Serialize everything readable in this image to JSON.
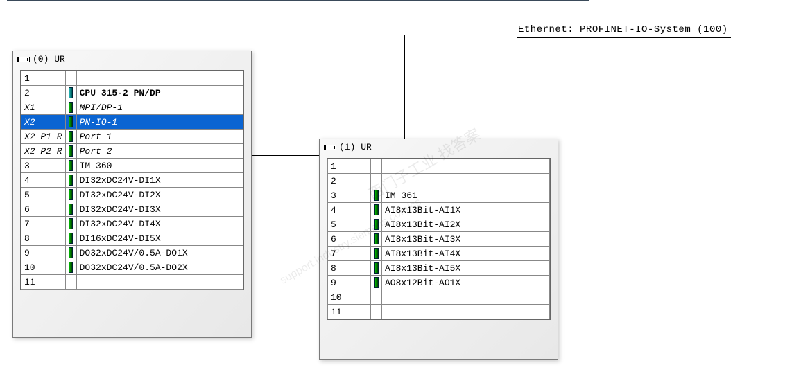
{
  "network_label": "Ethernet: PROFINET-IO-System (100)",
  "rack0": {
    "title": "(0) UR",
    "rows": [
      {
        "slot": "1",
        "icon": "",
        "module": ""
      },
      {
        "slot": "2",
        "icon": "teal",
        "module": "CPU 315-2 PN/DP",
        "bold": true
      },
      {
        "slot": "X1",
        "icon": "green",
        "module": "MPI/DP-1",
        "italic": true,
        "slotItalic": true
      },
      {
        "slot": "X2",
        "icon": "green",
        "module": "PN-IO-1",
        "italic": true,
        "slotItalic": true,
        "selected": true
      },
      {
        "slot": "X2 P1 R",
        "icon": "green",
        "module": "Port 1",
        "italic": true,
        "slotItalic": true
      },
      {
        "slot": "X2 P2 R",
        "icon": "green",
        "module": "Port 2",
        "italic": true,
        "slotItalic": true
      },
      {
        "slot": "3",
        "icon": "green",
        "module": "IM 360"
      },
      {
        "slot": "4",
        "icon": "green",
        "module": "DI32xDC24V-DI1X"
      },
      {
        "slot": "5",
        "icon": "green",
        "module": "DI32xDC24V-DI2X"
      },
      {
        "slot": "6",
        "icon": "green",
        "module": "DI32xDC24V-DI3X"
      },
      {
        "slot": "7",
        "icon": "green",
        "module": "DI32xDC24V-DI4X"
      },
      {
        "slot": "8",
        "icon": "green",
        "module": "DI16xDC24V-DI5X"
      },
      {
        "slot": "9",
        "icon": "green",
        "module": "DO32xDC24V/0.5A-DO1X"
      },
      {
        "slot": "10",
        "icon": "green",
        "module": "DO32xDC24V/0.5A-DO2X"
      },
      {
        "slot": "11",
        "icon": "",
        "module": ""
      }
    ]
  },
  "rack1": {
    "title": "(1) UR",
    "rows": [
      {
        "slot": "1",
        "icon": "",
        "module": ""
      },
      {
        "slot": "2",
        "icon": "",
        "module": ""
      },
      {
        "slot": "3",
        "icon": "green",
        "module": "IM 361"
      },
      {
        "slot": "4",
        "icon": "green",
        "module": "AI8x13Bit-AI1X"
      },
      {
        "slot": "5",
        "icon": "green",
        "module": "AI8x13Bit-AI2X"
      },
      {
        "slot": "6",
        "icon": "green",
        "module": "AI8x13Bit-AI3X"
      },
      {
        "slot": "7",
        "icon": "green",
        "module": "AI8x13Bit-AI4X"
      },
      {
        "slot": "8",
        "icon": "green",
        "module": "AI8x13Bit-AI5X"
      },
      {
        "slot": "9",
        "icon": "green",
        "module": "AO8x12Bit-AO1X"
      },
      {
        "slot": "10",
        "icon": "",
        "module": ""
      },
      {
        "slot": "11",
        "icon": "",
        "module": ""
      }
    ]
  },
  "watermarks": {
    "w1": "西门子工业 找答案",
    "w2": "support.industry.siemens.com/cs"
  }
}
